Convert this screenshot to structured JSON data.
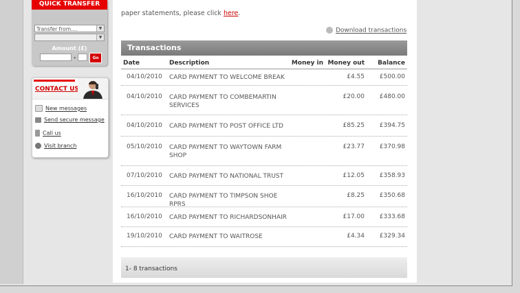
{
  "quick_transfer": {
    "title": "QUICK TRANSFER",
    "transfer_from": "Transfer from....",
    "transfer_to": "",
    "amount_label": "Amount (£)",
    "decimal": ".",
    "go_label": "Go"
  },
  "contact": {
    "title": "CONTACT US",
    "items": [
      {
        "label": "New messages",
        "icon": "envelope-icon"
      },
      {
        "label": "Send secure message",
        "icon": "arrow-icon"
      },
      {
        "label": "Call us",
        "icon": "phone-icon"
      },
      {
        "label": "Visit branch",
        "icon": "globe-icon"
      }
    ]
  },
  "main": {
    "intro_text": "paper statements, please click",
    "intro_link": "here",
    "intro_end": ".",
    "download_label": "Download transactions",
    "transactions_title": "Transactions",
    "columns": {
      "date": "Date",
      "description": "Description",
      "money_in": "Money in",
      "money_out": "Money out",
      "balance": "Balance"
    },
    "rows": [
      {
        "date": "04/10/2010",
        "description": "CARD PAYMENT TO WELCOME BREAK",
        "money_in": "",
        "money_out": "£4.55",
        "balance": "£500.00"
      },
      {
        "date": "04/10/2010",
        "description": "CARD PAYMENT TO COMBEMARTIN SERVICES",
        "money_in": "",
        "money_out": "£20.00",
        "balance": "£480.00"
      },
      {
        "date": "04/10/2010",
        "description": "CARD PAYMENT TO POST OFFICE LTD",
        "money_in": "",
        "money_out": "£85.25",
        "balance": "£394.75"
      },
      {
        "date": "05/10/2010",
        "description": "CARD PAYMENT TO WAYTOWN FARM SHOP",
        "money_in": "",
        "money_out": "£23.77",
        "balance": "£370.98"
      },
      {
        "date": "07/10/2010",
        "description": "CARD PAYMENT TO NATIONAL TRUST",
        "money_in": "",
        "money_out": "£12.05",
        "balance": "£358.93"
      },
      {
        "date": "16/10/2010",
        "description": "CARD PAYMENT TO TIMPSON SHOE RPRS",
        "money_in": "",
        "money_out": "£8.25",
        "balance": "£350.68"
      },
      {
        "date": "16/10/2010",
        "description": "CARD PAYMENT TO RICHARDSONHAIR",
        "money_in": "",
        "money_out": "£17.00",
        "balance": "£333.68"
      },
      {
        "date": "19/10/2010",
        "description": "CARD PAYMENT TO WAITROSE",
        "money_in": "",
        "money_out": "£4.34",
        "balance": "£329.34"
      }
    ],
    "footer": "1- 8 transactions"
  },
  "colors": {
    "brand_red": "#e60000",
    "header_grey": "#8a8a8a"
  }
}
